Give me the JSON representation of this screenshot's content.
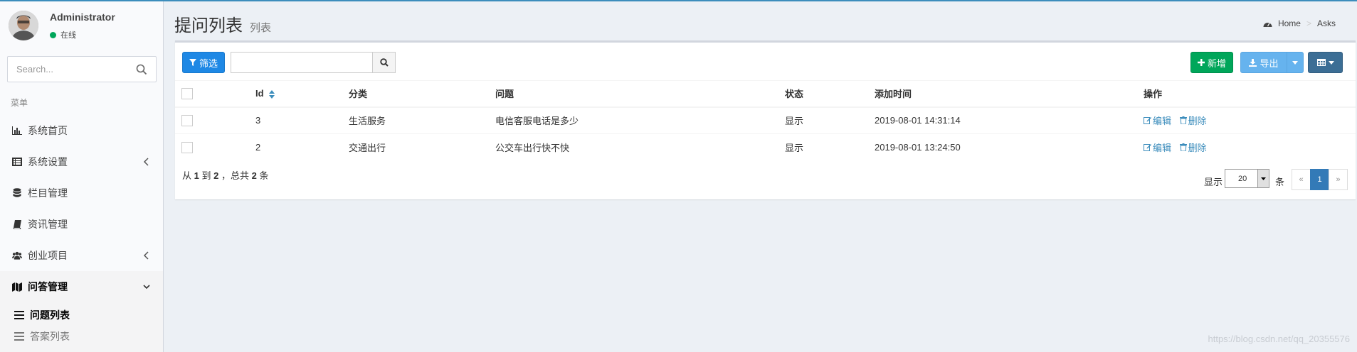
{
  "user": {
    "name": "Administrator",
    "status": "在线"
  },
  "sidebar": {
    "search_placeholder": "Search...",
    "menu_header": "菜单",
    "items": [
      {
        "label": "系统首页",
        "icon": "bar-chart-icon"
      },
      {
        "label": "系统设置",
        "icon": "list-alt-icon"
      },
      {
        "label": "栏目管理",
        "icon": "database-icon"
      },
      {
        "label": "资讯管理",
        "icon": "book-icon"
      },
      {
        "label": "创业项目",
        "icon": "users-icon"
      },
      {
        "label": "问答管理",
        "icon": "map-icon"
      }
    ],
    "sub_items": [
      {
        "label": "问题列表"
      },
      {
        "label": "答案列表"
      }
    ]
  },
  "header": {
    "title": "提问列表",
    "subtitle": "列表"
  },
  "breadcrumb": {
    "home": "Home",
    "current": "Asks"
  },
  "toolbar": {
    "filter": "筛选",
    "add": "新增",
    "export": "导出"
  },
  "table": {
    "columns": [
      "Id",
      "分类",
      "问题",
      "状态",
      "添加时间",
      "操作"
    ],
    "rows": [
      {
        "id": "3",
        "category": "生活服务",
        "question": "电信客服电话是多少",
        "status": "显示",
        "time": "2019-08-01 14:31:14",
        "edit": "编辑",
        "delete": "删除"
      },
      {
        "id": "2",
        "category": "交通出行",
        "question": "公交车出行快不快",
        "status": "显示",
        "time": "2019-08-01 13:24:50",
        "edit": "编辑",
        "delete": "删除"
      }
    ]
  },
  "pagination": {
    "summary_from": "从",
    "start": "1",
    "to": "到",
    "end": "2",
    "total_prefix": "，总共",
    "total": "2",
    "total_suffix": "条",
    "show_label": "显示",
    "page_size": "20",
    "unit": "条",
    "prev": "«",
    "current": "1",
    "next": "»"
  },
  "watermark": "https://blog.csdn.net/qq_20355576",
  "colors": {
    "primary": "#3c8dbc",
    "success": "#00a65a",
    "category_red": "#dd1111",
    "question_blue": "#1010a0"
  }
}
